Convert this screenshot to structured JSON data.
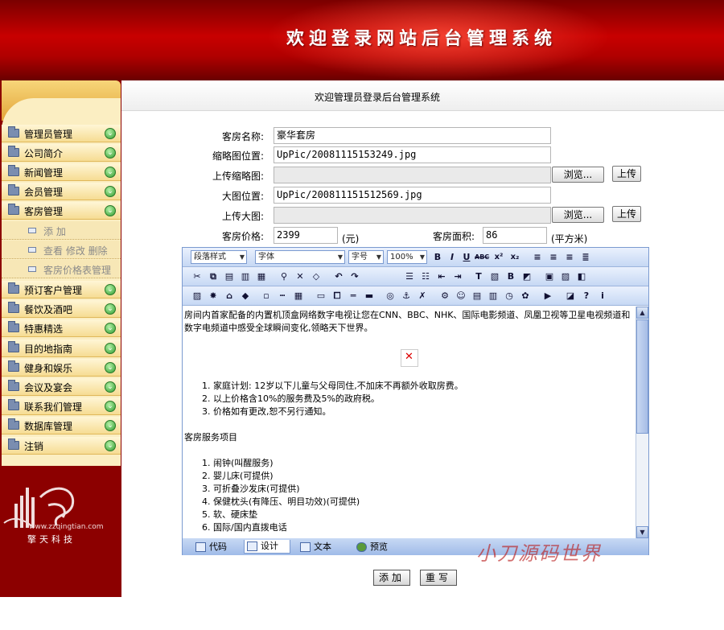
{
  "banner": {
    "title": "欢迎登录网站后台管理系统"
  },
  "header": {
    "welcome": "欢迎管理员登录后台管理系统"
  },
  "sidebar": {
    "items": [
      {
        "label": "管理员管理"
      },
      {
        "label": "公司简介"
      },
      {
        "label": "新闻管理"
      },
      {
        "label": "会员管理"
      },
      {
        "label": "客房管理"
      }
    ],
    "sub_items": [
      {
        "label": "添 加"
      },
      {
        "label": "查看 修改 删除"
      },
      {
        "label": "客房价格表管理"
      }
    ],
    "items2": [
      {
        "label": "预订客户管理"
      },
      {
        "label": "餐饮及酒吧"
      },
      {
        "label": "特惠精选"
      },
      {
        "label": "目的地指南"
      },
      {
        "label": "健身和娱乐"
      },
      {
        "label": "会议及宴会"
      },
      {
        "label": "联系我们管理"
      },
      {
        "label": "数据库管理"
      },
      {
        "label": "注销"
      }
    ],
    "logo_url": "www.zzqingtian.com",
    "logo_name": "擎天科技"
  },
  "form": {
    "room_name_label": "客房名称:",
    "room_name_value": "豪华套房",
    "thumb_path_label": "缩略图位置:",
    "thumb_path_value": "UpPic/20081115153249.jpg",
    "upload_thumb_label": "上传缩略图:",
    "big_path_label": "大图位置:",
    "big_path_value": "UpPic/20081115151256​9.jpg",
    "upload_big_label": "上传大图:",
    "browse_label": "浏览...",
    "upload_label": "上传",
    "price_label": "客房价格:",
    "price_value": "2399",
    "price_unit": "(元)",
    "area_label": "客房面积:",
    "area_value": "86",
    "area_unit": "(平方米)"
  },
  "editor": {
    "style_select": "段落样式",
    "font_select": "字体",
    "size_select": "字号",
    "zoom_select": "100%",
    "intro": "房间内首家配备的内置机顶盒网络数字电视让您在CNN、BBC、NHK、国际电影频道、凤凰卫视等卫星电视频道和数字电频道中感受全球瞬间变化,领略天下世界。",
    "notes": [
      "家庭计划: 12岁以下儿童与父母同住,不加床不再额外收取房费。",
      "以上价格含10%的服务费及5%的政府税。",
      "价格如有更改,恕不另行通知。"
    ],
    "services_title": "客房服务项目",
    "services": [
      "闹钟(叫醒服务)",
      "婴儿床(可提供)",
      "可折叠沙发床(可提供)",
      "保健枕头(有降压、明目功效)(可提供)",
      "软、硬床垫",
      "国际/国内直拨电话"
    ],
    "tab_code": "代码",
    "tab_design": "设计",
    "tab_text": "文本",
    "tab_preview": "预览"
  },
  "actions": {
    "add": "添加",
    "reset": "重写"
  },
  "watermark": "小刀源码世界"
}
